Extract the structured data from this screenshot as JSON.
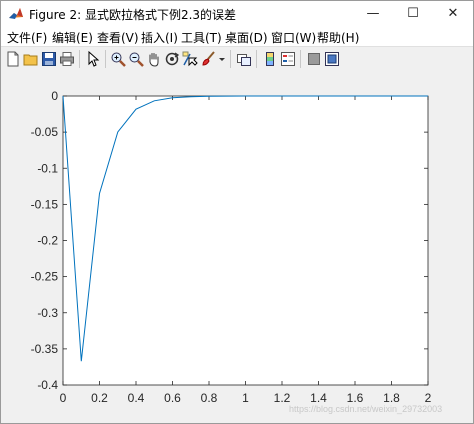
{
  "window": {
    "title": "Figure 2: 显式欧拉格式下例2.3的误差",
    "controls": {
      "minimize": "—",
      "maximize": "☐",
      "close": "✕"
    }
  },
  "menubar": {
    "items": [
      "文件(F)",
      "编辑(E)",
      "查看(V)",
      "插入(I)",
      "工具(T)",
      "桌面(D)",
      "窗口(W)",
      "帮助(H)"
    ]
  },
  "toolbar": {
    "icons": [
      "new-figure-icon",
      "open-file-icon",
      "save-icon",
      "print-icon",
      "pointer-icon",
      "zoom-in-icon",
      "zoom-out-icon",
      "pan-hand-icon",
      "rotate-3d-icon",
      "data-cursor-icon",
      "brush-icon",
      "brush-dropdown-icon",
      "link-plot-icon",
      "colorbar-icon",
      "legend-icon",
      "hide-plot-tools-icon",
      "show-plot-tools-icon"
    ]
  },
  "chart_data": {
    "type": "line",
    "title": "",
    "xlabel": "",
    "ylabel": "",
    "xlim": [
      0,
      2
    ],
    "ylim": [
      -0.4,
      0
    ],
    "xticks": [
      0,
      0.2,
      0.4,
      0.6,
      0.8,
      1,
      1.2,
      1.4,
      1.6,
      1.8,
      2
    ],
    "xtick_labels": [
      "0",
      "0.2",
      "0.4",
      "0.6",
      "0.8",
      "1",
      "1.2",
      "1.4",
      "1.6",
      "1.8",
      "2"
    ],
    "yticks": [
      0,
      -0.05,
      -0.1,
      -0.15,
      -0.2,
      -0.25,
      -0.3,
      -0.35,
      -0.4
    ],
    "ytick_labels": [
      "0",
      "-0.05",
      "-0.1",
      "-0.15",
      "-0.2",
      "-0.25",
      "-0.3",
      "-0.35",
      "-0.4"
    ],
    "grid": false,
    "line_color": "#0072bd",
    "series": [
      {
        "x": [
          0,
          0.1,
          0.2,
          0.3,
          0.4,
          0.5,
          0.6,
          0.7,
          0.8,
          0.9,
          1.0,
          1.1,
          1.2,
          1.3,
          1.4,
          1.5,
          1.6,
          1.7,
          1.8,
          1.9,
          2.0
        ],
        "values": [
          0,
          -0.367,
          -0.135,
          -0.0498,
          -0.0183,
          -0.0067,
          -0.0025,
          -0.0009,
          -0.0003,
          -0.0001,
          0,
          0,
          0,
          0,
          0,
          0,
          0,
          0,
          0,
          0,
          0
        ]
      }
    ]
  },
  "watermark": "https://blog.csdn.net/weixin_29732003"
}
